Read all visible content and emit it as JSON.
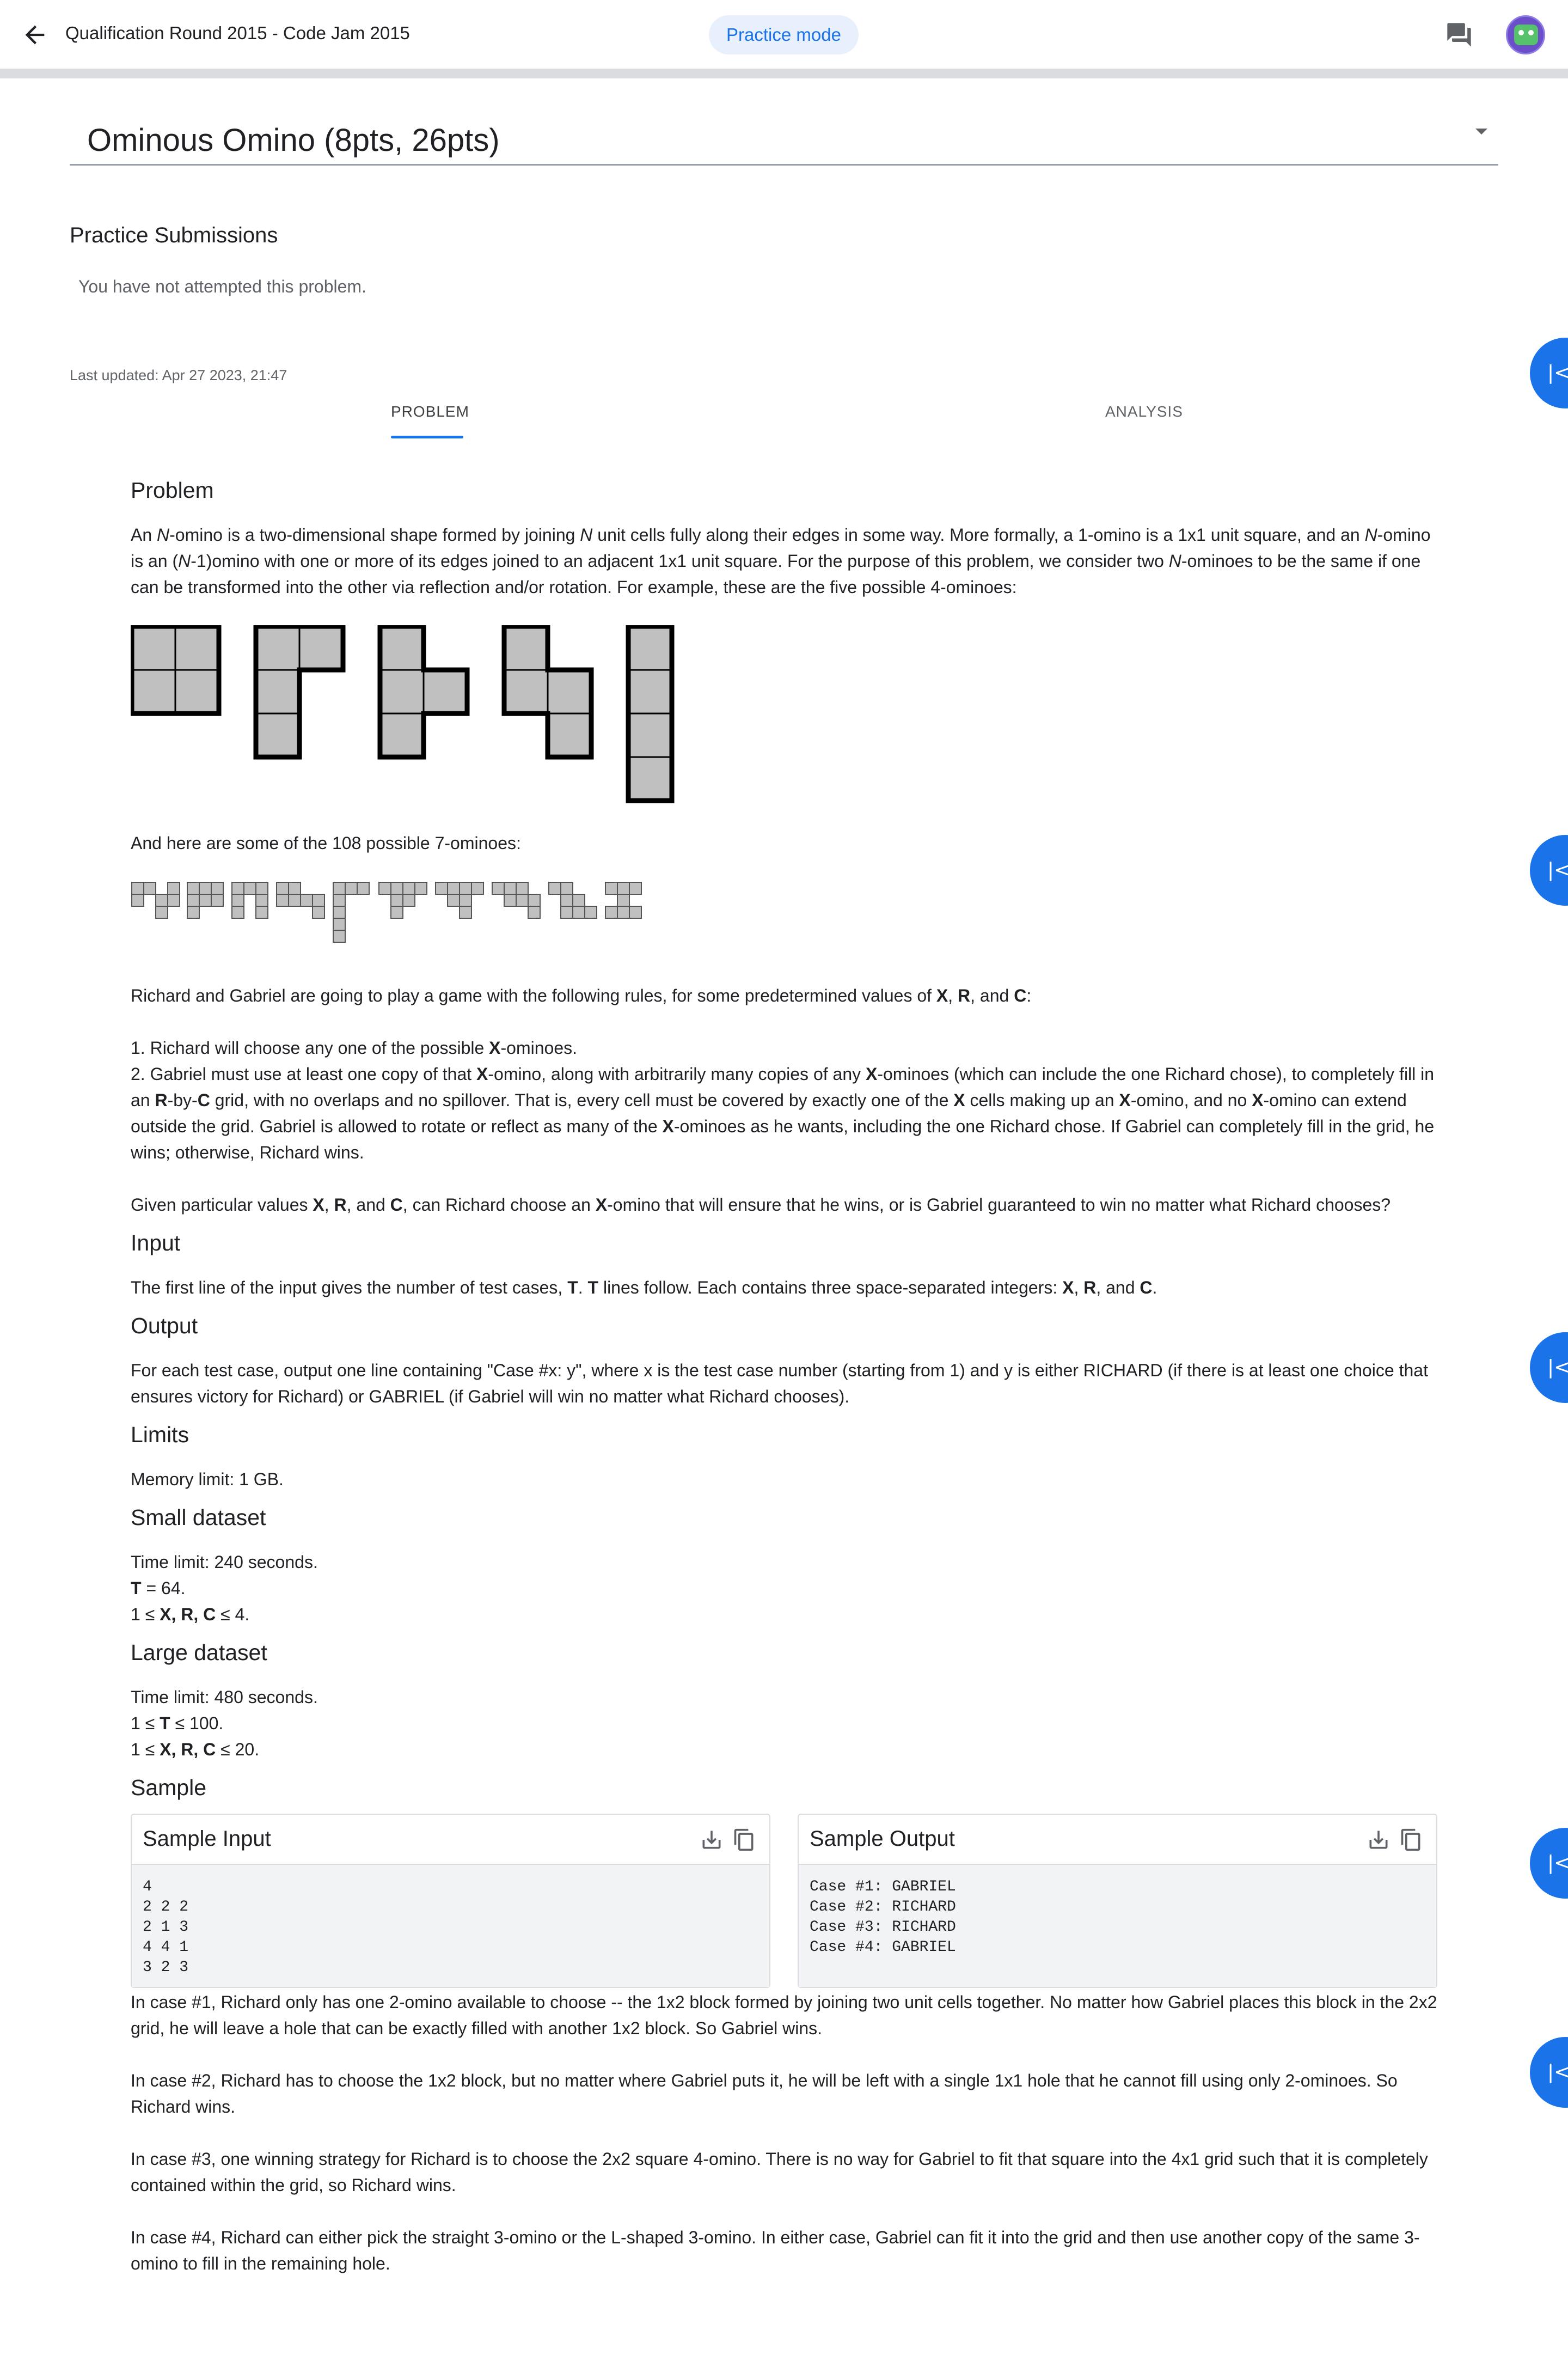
{
  "header": {
    "contest_title": "Qualification Round 2015 - Code Jam 2015",
    "mode_label": "Practice mode"
  },
  "problem_select": {
    "title": "Ominous Omino (8pts, 26pts)"
  },
  "submissions": {
    "heading": "Practice Submissions",
    "empty_text": "You have not attempted this problem."
  },
  "last_updated": "Last updated: Apr 27 2023, 21:47",
  "tabs": [
    {
      "label": "PROBLEM",
      "active": true
    },
    {
      "label": "ANALYSIS",
      "active": false
    }
  ],
  "side_buttons": {
    "glyph": "|<",
    "count": 5
  },
  "problem": {
    "heading": "Problem",
    "p1": {
      "s1": "An ",
      "n1": "N",
      "s2": "-omino is a two-dimensional shape formed by joining ",
      "n2": "N",
      "s3": " unit cells fully along their edges in some way. More formally, a 1-omino is a 1x1 unit square, and an ",
      "n3": "N",
      "s4": "-omino is an (",
      "n4": "N",
      "s5": "-1)omino with one or more of its edges joined to an adjacent 1x1 unit square. For the purpose of this problem, we consider two ",
      "n5": "N",
      "s6": "-ominoes to be the same if one can be transformed into the other via reflection and/or rotation. For example, these are the five possible 4-ominoes:"
    },
    "p2": "And here are some of the 108 possible 7-ominoes:",
    "p3": {
      "s1": "Richard and Gabriel are going to play a game with the following rules, for some predetermined values of ",
      "x": "X",
      "s2": ", ",
      "r": "R",
      "s3": ", and ",
      "c": "C",
      "s4": ":"
    },
    "rule1": {
      "s1": "1. Richard will choose any one of the possible ",
      "x": "X",
      "s2": "-ominoes."
    },
    "rule2": {
      "s1": "2. Gabriel must use at least one copy of that ",
      "x1": "X",
      "s2": "-omino, along with arbitrarily many copies of any ",
      "x2": "X",
      "s3": "-ominoes (which can include the one Richard chose), to completely fill in an ",
      "r": "R",
      "s4": "-by-",
      "c": "C",
      "s5": " grid, with no overlaps and no spillover. That is, every cell must be covered by exactly one of the ",
      "x3": "X",
      "s6": " cells making up an ",
      "x4": "X",
      "s7": "-omino, and no ",
      "x5": "X",
      "s8": "-omino can extend outside the grid. Gabriel is allowed to rotate or reflect as many of the ",
      "x6": "X",
      "s9": "-ominoes as he wants, including the one Richard chose. If Gabriel can completely fill in the grid, he wins; otherwise, Richard wins."
    },
    "p4": {
      "s1": "Given particular values ",
      "x": "X",
      "s2": ", ",
      "r": "R",
      "s3": ", and ",
      "c": "C",
      "s4": ", can Richard choose an ",
      "x2": "X",
      "s5": "-omino that will ensure that he wins, or is Gabriel guaranteed to win no matter what Richard chooses?"
    }
  },
  "input": {
    "heading": "Input",
    "s1": "The first line of the input gives the number of test cases, ",
    "t1": "T",
    "s2": ". ",
    "t2": "T",
    "s3": " lines follow. Each contains three space-separated integers: ",
    "x": "X",
    "s4": ", ",
    "r": "R",
    "s5": ", and ",
    "c": "C",
    "s6": "."
  },
  "output": {
    "heading": "Output",
    "text": "For each test case, output one line containing \"Case #x: y\", where x is the test case number (starting from 1) and y is either RICHARD (if there is at least one choice that ensures victory for Richard) or GABRIEL (if Gabriel will win no matter what Richard chooses)."
  },
  "limits": {
    "heading": "Limits",
    "memory": "Memory limit: 1 GB."
  },
  "small": {
    "heading": "Small dataset",
    "time": "Time limit: 240 seconds.",
    "t_bold": "T",
    "t_rest": " = 64.",
    "xrc_pre": "1 ≤ ",
    "xrc_bold": "X, R, C",
    "xrc_post": " ≤ 4."
  },
  "large": {
    "heading": "Large dataset",
    "time": "Time limit: 480 seconds.",
    "t_pre": "1 ≤ ",
    "t_bold": "T",
    "t_post": " ≤ 100.",
    "xrc_pre": "1 ≤ ",
    "xrc_bold": "X, R, C",
    "xrc_post": " ≤ 20."
  },
  "sample": {
    "heading": "Sample",
    "input_title": "Sample Input",
    "input_text": "4\n2 2 2\n2 1 3\n4 4 1\n3 2 3",
    "output_title": "Sample Output",
    "output_text": "Case #1: GABRIEL\nCase #2: RICHARD\nCase #3: RICHARD\nCase #4: GABRIEL"
  },
  "explanations": [
    "In case #1, Richard only has one 2-omino available to choose -- the 1x2 block formed by joining two unit cells together. No matter how Gabriel places this block in the 2x2 grid, he will leave a hole that can be exactly filled with another 1x2 block. So Gabriel wins.",
    "In case #2, Richard has to choose the 1x2 block, but no matter where Gabriel puts it, he will be left with a single 1x1 hole that he cannot fill using only 2-ominoes. So Richard wins.",
    "In case #3, one winning strategy for Richard is to choose the 2x2 square 4-omino. There is no way for Gabriel to fit that square into the 4x1 grid such that it is completely contained within the grid, so Richard wins.",
    "In case #4, Richard can either pick the straight 3-omino or the L-shaped 3-omino. In either case, Gabriel can fit it into the grid and then use another copy of the same 3-omino to fill in the remaining hole."
  ],
  "colors": {
    "accent": "#1a73e8",
    "pill_bg": "#e8f0fe",
    "omino_fill": "#c0c0c0"
  }
}
